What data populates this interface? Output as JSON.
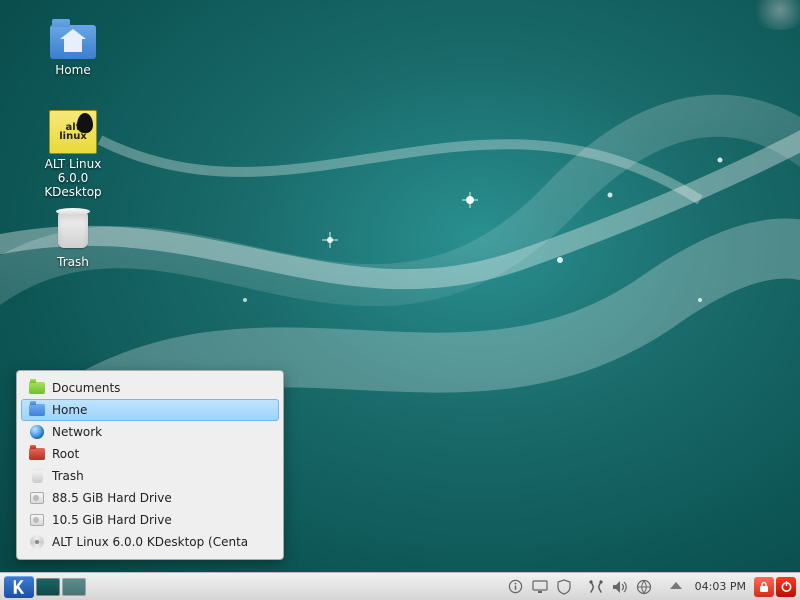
{
  "desktop": {
    "icons": [
      {
        "name": "home",
        "label": "Home"
      },
      {
        "name": "alt",
        "label": "ALT Linux 6.0.0 KDesktop"
      },
      {
        "name": "trash",
        "label": "Trash"
      }
    ],
    "alt_badge": {
      "line1": "alt",
      "line2": "linux"
    }
  },
  "popup": {
    "items": [
      {
        "label": "Documents",
        "icon": "folder-green",
        "selected": false
      },
      {
        "label": "Home",
        "icon": "folder-blue",
        "selected": true
      },
      {
        "label": "Network",
        "icon": "globe",
        "selected": false
      },
      {
        "label": "Root",
        "icon": "folder-red",
        "selected": false
      },
      {
        "label": "Trash",
        "icon": "trash",
        "selected": false
      },
      {
        "label": "88.5 GiB Hard Drive",
        "icon": "hdd",
        "selected": false
      },
      {
        "label": "10.5 GiB Hard Drive",
        "icon": "hdd",
        "selected": false
      },
      {
        "label": "ALT Linux 6.0.0 KDesktop (Centa",
        "icon": "disc",
        "selected": false
      }
    ]
  },
  "taskbar": {
    "clock": "04:03 PM",
    "tray_icons": [
      "info-icon",
      "display-icon",
      "security-icon",
      "clipboard-icon",
      "volume-icon",
      "network-icon",
      "show-desktop-icon"
    ]
  }
}
